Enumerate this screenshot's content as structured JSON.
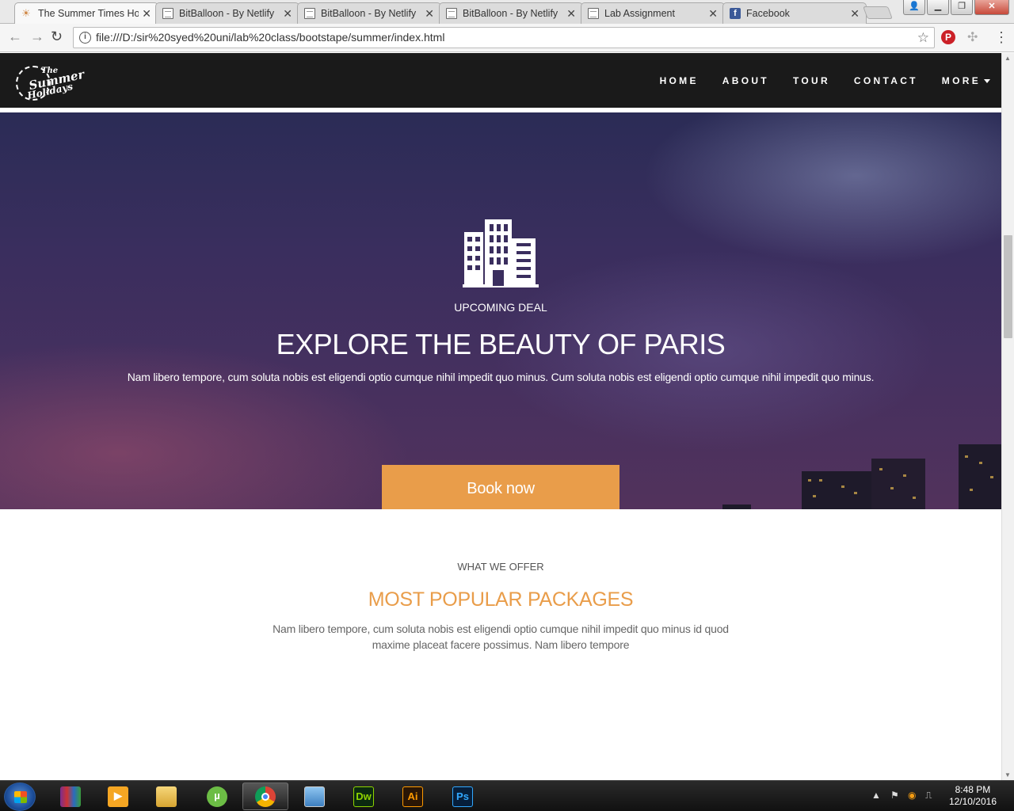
{
  "browser": {
    "tabs": [
      {
        "title": "The Summer Times Ho",
        "favicon": "sun-icon",
        "active": true
      },
      {
        "title": "BitBalloon - By Netlify",
        "favicon": "page-icon",
        "active": false
      },
      {
        "title": "BitBalloon - By Netlify",
        "favicon": "page-icon",
        "active": false
      },
      {
        "title": "BitBalloon - By Netlify",
        "favicon": "page-icon",
        "active": false
      },
      {
        "title": "Lab Assignment",
        "favicon": "page-icon",
        "active": false
      },
      {
        "title": "Facebook",
        "favicon": "facebook-icon",
        "active": false
      }
    ],
    "url": "file:///D:/sir%20syed%20uni/lab%20class/bootstape/summer/index.html"
  },
  "site": {
    "logo": {
      "line1": "The",
      "line2": "Summer",
      "line3": "Holidays"
    },
    "nav": [
      "HOME",
      "ABOUT",
      "TOUR",
      "CONTACT",
      "MORE"
    ],
    "hero": {
      "icon": "building-icon",
      "kicker": "UPCOMING DEAL",
      "title": "EXPLORE THE BEAUTY OF PARIS",
      "text": "Nam libero tempore, cum soluta nobis est eligendi optio cumque nihil impedit quo minus. Cum soluta nobis est eligendi optio cumque nihil impedit quo minus.",
      "button": "Book now"
    },
    "offer": {
      "kicker": "WHAT WE OFFER",
      "title": "MOST POPULAR PACKAGES",
      "text": "Nam libero tempore, cum soluta nobis est eligendi optio cumque nihil impedit quo minus id quod maxime placeat facere possimus. Nam libero tempore"
    },
    "colors": {
      "accent": "#e99d4a",
      "nav_bg": "#1a1a1a"
    }
  },
  "taskbar": {
    "apps": [
      {
        "name": "winrar-icon",
        "label": ""
      },
      {
        "name": "media-player-icon",
        "label": ""
      },
      {
        "name": "file-explorer-icon",
        "label": ""
      },
      {
        "name": "utorrent-icon",
        "label": ""
      },
      {
        "name": "chrome-icon",
        "label": ""
      },
      {
        "name": "photo-viewer-icon",
        "label": ""
      },
      {
        "name": "dreamweaver-icon",
        "label": "Dw"
      },
      {
        "name": "illustrator-icon",
        "label": "Ai"
      },
      {
        "name": "photoshop-icon",
        "label": "Ps"
      }
    ],
    "time": "8:48 PM",
    "date": "12/10/2016"
  }
}
